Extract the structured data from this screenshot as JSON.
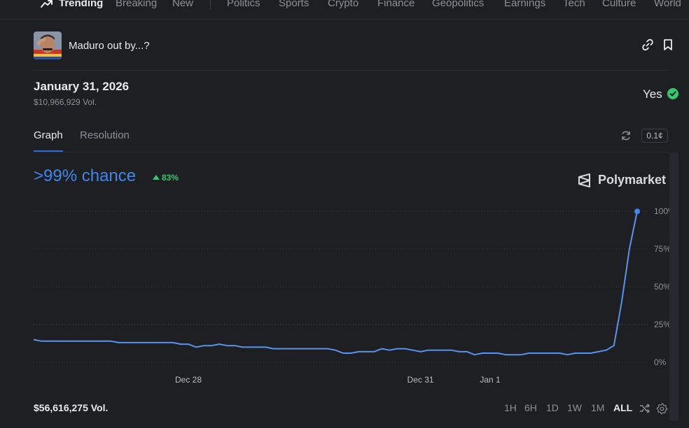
{
  "nav": {
    "items": [
      "Trending",
      "Breaking",
      "New",
      "Politics",
      "Sports",
      "Crypto",
      "Finance",
      "Geopolitics",
      "Earnings",
      "Tech",
      "Culture",
      "World"
    ],
    "active": "Trending"
  },
  "market": {
    "title": "Maduro out by...?",
    "thumbnail_icon": "market-thumbnail"
  },
  "outcome_header": {
    "date": "January 31, 2026",
    "volume": "$10,966,929 Vol.",
    "outcome_label": "Yes",
    "outcome_color": "#39c46e"
  },
  "tabs": {
    "graph": "Graph",
    "resolution": "Resolution",
    "active": "Graph",
    "tick_size": "0.1¢"
  },
  "chance": {
    "text": ">99% chance",
    "delta": "83%",
    "color": "#3e86f0",
    "delta_color": "#39c46e"
  },
  "brand": {
    "name": "Polymarket"
  },
  "chart_data": {
    "type": "line",
    "x_tick_labels": [
      "Dec 28",
      "Dec 31",
      "Jan 1"
    ],
    "y_tick_labels": [
      "100%",
      "75%",
      "50%",
      "25%",
      "0%"
    ],
    "ylim": [
      0,
      100
    ],
    "grid": true,
    "line_color": "#5a93ea",
    "series": [
      {
        "values": [
          15,
          14,
          14,
          14,
          14,
          14,
          14,
          14,
          14,
          14,
          14,
          13,
          13,
          13,
          13,
          13,
          13,
          13,
          13,
          12,
          12,
          10,
          11,
          11,
          12,
          11,
          11,
          10,
          10,
          10,
          10,
          9,
          9,
          9,
          9,
          9,
          9,
          9,
          9,
          8,
          6,
          6,
          7,
          7,
          7,
          9,
          8,
          9,
          9,
          8,
          7,
          8,
          8,
          8,
          8,
          7,
          7,
          5,
          6,
          6,
          6,
          5,
          5,
          5,
          6,
          6,
          6,
          6,
          6,
          5,
          6,
          6,
          6,
          7,
          8,
          11,
          40,
          75,
          99.9
        ]
      }
    ]
  },
  "footer": {
    "volume": "$56,616,275 Vol.",
    "ranges": [
      "1H",
      "6H",
      "1D",
      "1W",
      "1M",
      "ALL"
    ],
    "active_range": "ALL"
  }
}
